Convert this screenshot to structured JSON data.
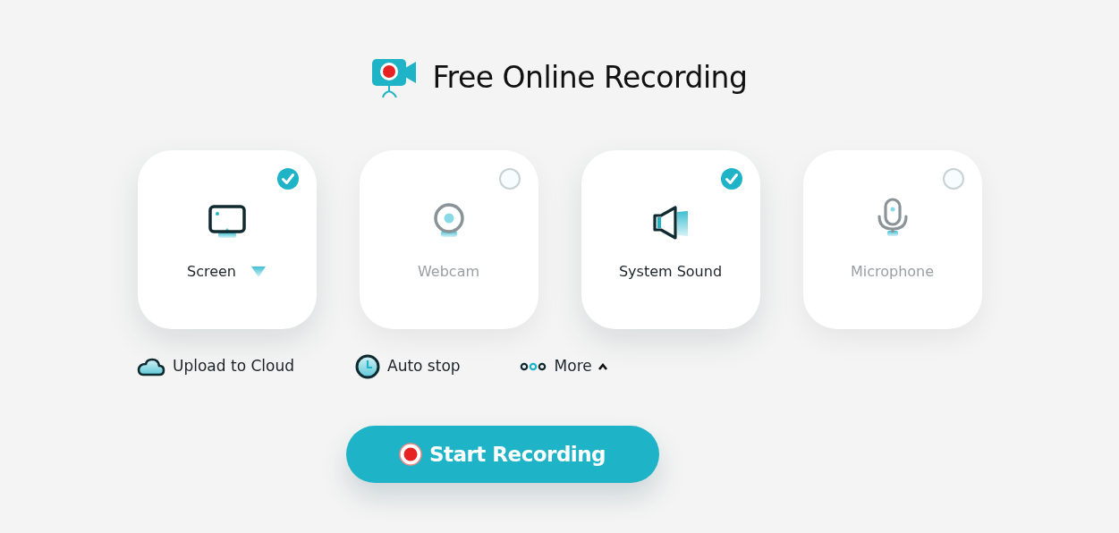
{
  "title": "Free Online Recording",
  "sources": [
    {
      "label": "Screen",
      "checked": true,
      "dropdown": true
    },
    {
      "label": "Webcam",
      "checked": false,
      "dropdown": false
    },
    {
      "label": "System Sound",
      "checked": true,
      "dropdown": false
    },
    {
      "label": "Microphone",
      "checked": false,
      "dropdown": false
    }
  ],
  "options": [
    {
      "label": "Upload to Cloud"
    },
    {
      "label": "Auto stop"
    },
    {
      "label": "More",
      "expanded": true
    }
  ],
  "start_button": "Start Recording"
}
